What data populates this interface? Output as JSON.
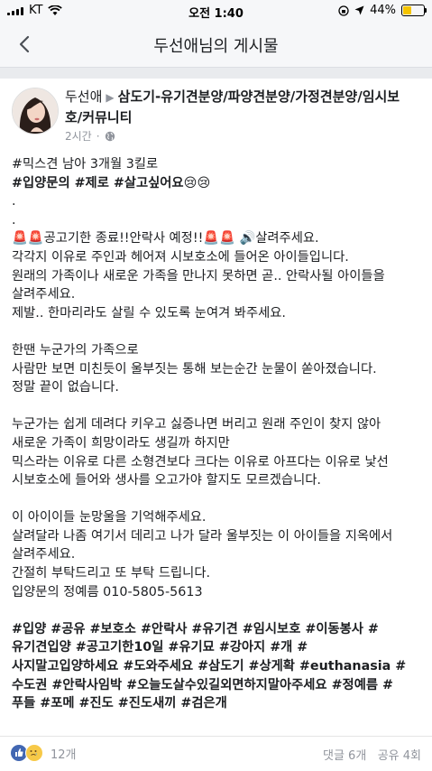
{
  "status_bar": {
    "carrier": "KT",
    "time": "오전 1:40",
    "battery": "44%",
    "battery_level": 0.44
  },
  "nav": {
    "title": "두선애님의 게시물"
  },
  "post": {
    "author": "두선애",
    "group": "삼도기-유기견분양/파양견분양/가정견분양/임시보호/커뮤니티",
    "time": "2시간",
    "lines": [
      "#믹스견 남아 3개월 3킬로",
      "#입양문의 #제로 #살고싶어요😢😢",
      ".",
      ".",
      "🚨🚨공고기한 종료!!안락사 예정!!🚨🚨 🔊살려주세요.",
      "각각지 이유로 주인과 헤어져 시보호소에 들어온 아이들입니다.",
      "원래의 가족이나 새로운 가족을 만나지 못하면 곧.. 안락사될 아이들을",
      "살려주세요.",
      "제발.. 한마리라도 살릴 수 있도록 눈여겨 봐주세요.",
      "",
      "한땐 누군가의 가족으로",
      "사람만 보면 미친듯이 울부짓는 통해 보는순간 눈물이 쏟아졌습니다.",
      "정말 끝이 없습니다.",
      "",
      "누군가는 쉽게 데려다 키우고 싫증나면 버리고 원래 주인이 찾지 않아",
      "새로운 가족이 희망이라도 생길까 하지만",
      "믹스라는 이유로 다른 소형견보다 크다는 이유로 아프다는 이유로 낯선",
      "시보호소에 들어와 생사를 오고가야 할지도 모르겠습니다.",
      "",
      "이 아이이들 눈망울을 기억해주세요.",
      "살려달라 나좀 여기서 데리고 나가 달라 울부짓는 이 아이들을 지옥에서",
      "살려주세요.",
      "간절히 부탁드리고 또 부탁 드립니다.",
      "입양문의 정예름 010-5805-5613",
      "",
      "#입양 #공유 #보호소 #안락사 #유기견 #임시보호  #이동봉사 #",
      "유기견입양 #공고기한10일 #유기묘 #강아지 #개 #",
      "사지말고입양하세요 #도와주세요 #삼도기 #상게확 #euthanasia #",
      "수도권 #안락사임박 #오늘도살수있길외면하지말아주세요 #정예름 #",
      "푸들 #포메 #진도 #진도새끼 #검은개"
    ],
    "reaction_count": "12개",
    "comments": "댓글 6개",
    "shares": "공유 4회"
  }
}
